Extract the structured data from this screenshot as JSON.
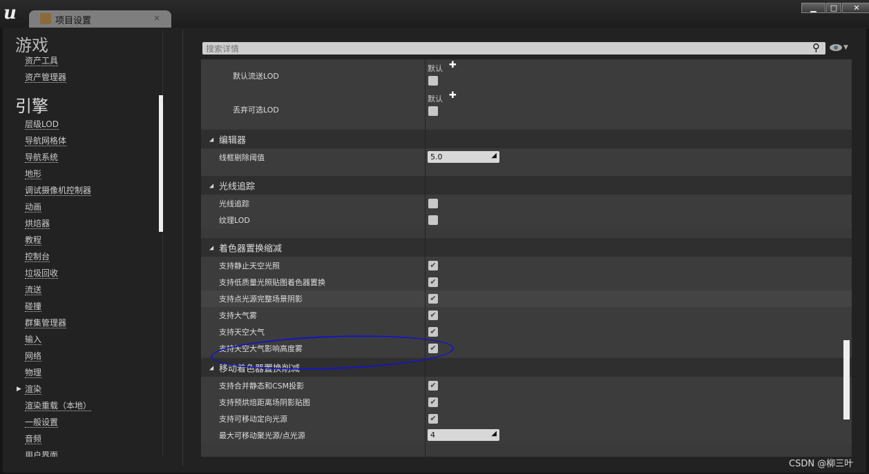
{
  "window": {
    "tab_title": "项目设置",
    "close": "×",
    "min": "▁",
    "max": "□",
    "close_win": "✕"
  },
  "sidebar": {
    "sections": [
      {
        "label": "游戏"
      },
      {
        "label": "引擎"
      }
    ],
    "game_items": [
      "资产工具",
      "资产管理器"
    ],
    "engine_items": [
      "层级LOD",
      "导航网格体",
      "导航系统",
      "地形",
      "调试摄像机控制器",
      "动画",
      "烘焙器",
      "教程",
      "控制台",
      "垃圾回收",
      "流送",
      "碰撞",
      "群集管理器",
      "输入",
      "网络",
      "物理",
      "渲染",
      "渲染重载（本地）",
      "一般设置",
      "音频",
      "用户界面"
    ],
    "expanded_item": "渲染"
  },
  "search": {
    "placeholder": "搜索详情"
  },
  "details": {
    "default_label": "默认",
    "lod_rows": [
      {
        "label": "默认流送LOD",
        "checked": false
      },
      {
        "label": "丢弃可选LOD",
        "checked": false
      }
    ],
    "sections": [
      {
        "title": "编辑器",
        "rows": [
          {
            "label": "线框剔除阈值",
            "value": "5.0"
          }
        ]
      },
      {
        "title": "光线追踪",
        "rows": [
          {
            "label": "光线追踪",
            "checked": false
          },
          {
            "label": "纹理LOD",
            "checked": false
          }
        ]
      },
      {
        "title": "着色器置换缩减",
        "rows": [
          {
            "label": "支持静止天空光照",
            "checked": true
          },
          {
            "label": "支持低质量光照贴图着色器置换",
            "checked": true
          },
          {
            "label": "支持点光源完整场景阴影",
            "checked": true
          },
          {
            "label": "支持大气雾",
            "checked": true
          },
          {
            "label": "支持天空大气",
            "checked": true
          },
          {
            "label": "支持天空大气影响高度雾",
            "checked": true
          }
        ]
      },
      {
        "title": "移动着色器置换削减",
        "rows": [
          {
            "label": "支持合并静态和CSM投影",
            "checked": true
          },
          {
            "label": "支持预烘焙距离场阴影贴图",
            "checked": true
          },
          {
            "label": "支持可移动定向光源",
            "checked": true
          },
          {
            "label": "最大可移动聚光源/点光源",
            "value": "4"
          }
        ]
      }
    ]
  },
  "annotation": {
    "highlighted_row": "支持天空大气影响高度雾",
    "color": "#1414c8"
  },
  "watermark": "CSDN @柳三叶"
}
